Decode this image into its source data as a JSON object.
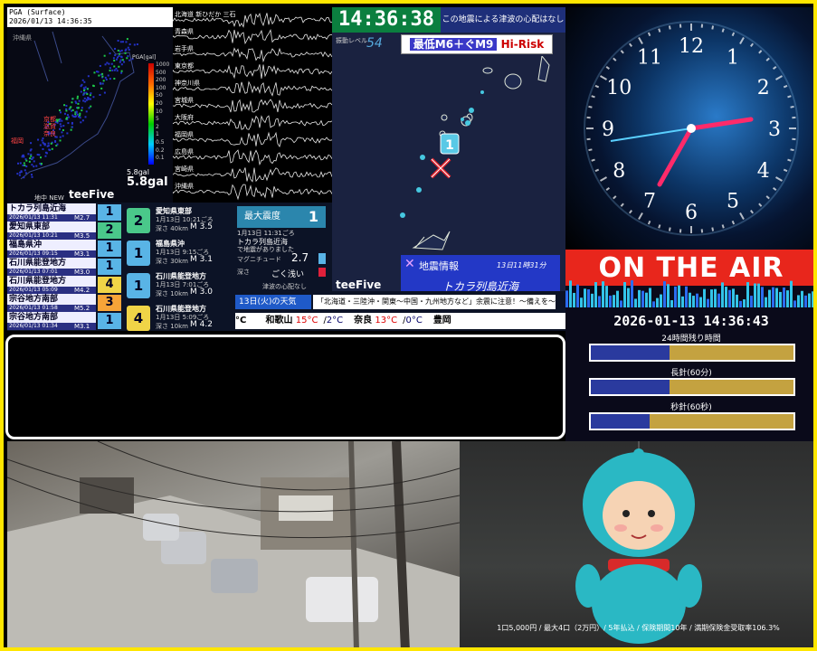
{
  "pga": {
    "timestamp_label": "PGA (Surface)",
    "timestamp": "2026/01/13 14:36:35",
    "scale_title": "PGA[gal]",
    "scale_ticks": [
      "1000",
      "500",
      "200",
      "100",
      "50",
      "20",
      "10",
      "5",
      "2",
      "1",
      "0.5",
      "0.2",
      "0.1"
    ],
    "gal_small": "5.8gal",
    "gal_value": "5.8gal",
    "footer": "地中 NEW",
    "brand": "teeFive",
    "regions": [
      "京都",
      "滋賀",
      "奈良",
      "福岡"
    ]
  },
  "seismo": {
    "stations": [
      "北海道 新ひだか 三石",
      "青森県 ",
      "岩手県 ",
      "東京都 ",
      "神奈川県",
      "宮城県 ",
      "大阪府",
      "福岡県 ",
      "広島県 ",
      "宮崎県",
      "沖縄県"
    ]
  },
  "map": {
    "clock": "14:36:38",
    "tsunami": "この地震による津波の心配はなし",
    "level_label": "振動レベル",
    "level_value": "54",
    "risk_prefix": "最低M6＋ぐM9",
    "risk_text": "Hi-Risk",
    "marker_intensity": "1",
    "info_title": "地震情報",
    "info_date": "13日11時31分",
    "info_region": "トカラ列島近海",
    "brand": "teeFive"
  },
  "quake_list": [
    {
      "name": "トカラ列島近海",
      "time": "2026/01/13 11:31",
      "mag": "M2.7",
      "shindo": "1",
      "color": "#59b4e6"
    },
    {
      "name": "愛知県東部",
      "time": "2026/01/13 10:21",
      "mag": "M3.5",
      "shindo": "2",
      "color": "#4ac88a"
    },
    {
      "name": "福島県沖",
      "time": "2026/01/13 09:15",
      "mag": "M3.1",
      "shindo": "1",
      "color": "#59b4e6"
    },
    {
      "name": "石川県能登地方",
      "time": "2026/01/13 07:01",
      "mag": "M3.0",
      "shindo": "1",
      "color": "#59b4e6"
    },
    {
      "name": "石川県能登地方",
      "time": "2026/01/13 05:09",
      "mag": "M4.2",
      "shindo": "4",
      "color": "#f0d447"
    },
    {
      "name": "宗谷地方南部",
      "time": "2026/01/13 01:58",
      "mag": "M5.2",
      "shindo": "3",
      "color": "#f7a438"
    },
    {
      "name": "宗谷地方南部",
      "time": "2026/01/13 01:34",
      "mag": "M3.1",
      "shindo": "1",
      "color": "#59b4e6"
    }
  ],
  "detail_cards": [
    {
      "badge": "2",
      "name": "愛知県東部",
      "time": "1月13日 10:21ごろ",
      "depth": "深さ 40km",
      "mag": "M 3.5",
      "color": "#4ac88a",
      "badge_text": "#002"
    },
    {
      "badge": "1",
      "name": "福島県沖",
      "time": "1月13日 9:15ごろ",
      "depth": "深さ 30km",
      "mag": "M 3.1",
      "color": "#59b4e6",
      "badge_text": "#002"
    },
    {
      "badge": "1",
      "name": "石川県能登地方",
      "time": "1月13日 7:01ごろ",
      "depth": "深さ 10km",
      "mag": "M 3.0",
      "color": "#59b4e6",
      "badge_text": "#002"
    },
    {
      "badge": "4",
      "name": "石川県能登地方",
      "time": "1月13日 5:09ごろ",
      "depth": "深さ 10km",
      "mag": "M 4.2",
      "color": "#f0d447",
      "badge_text": "#002"
    }
  ],
  "max_intensity": {
    "label": "最大震度",
    "value": "1",
    "time": "1月13日 11:31ごろ",
    "region": "トカラ列島近海",
    "note": "で地震がありました",
    "mag_label": "マグニチュード",
    "mag_value": "2.7",
    "depth_label": "深さ",
    "depth_value": "ごく浅い",
    "tsunami_note": "津波の心配なし"
  },
  "weather": {
    "header": "13日(火)の天気",
    "warning": "「北海道・三陸沖・関東〜中国・九州地方など」余震に注意！〜備えを〜",
    "cities": [
      {
        "name": "°C",
        "hi": "",
        "lo": ""
      },
      {
        "name": "和歌山",
        "hi": "15°C",
        "lo": "2°C"
      },
      {
        "name": "奈良",
        "hi": "13°C",
        "lo": "0°C"
      },
      {
        "name": "豊岡",
        "hi": "",
        "lo": ""
      }
    ]
  },
  "earth_clock": {
    "numerals": [
      "12",
      "1",
      "2",
      "3",
      "4",
      "5",
      "6",
      "7",
      "8",
      "9",
      "10",
      "11"
    ]
  },
  "on_air": {
    "banner": "ON THE AIR",
    "datetime": "2026-01-13 14:36:43",
    "bars": [
      {
        "label": "24時間残り時間",
        "fill": 0.39
      },
      {
        "label": "長針(60分)",
        "fill": 0.39
      },
      {
        "label": "秒針(60秒)",
        "fill": 0.29
      }
    ]
  },
  "cam2": {
    "caption": "1口5,000円 / 最大4口（2万円）/ 5年払込 / 保険期間10年 / 満期保険金受取率106.3%"
  }
}
